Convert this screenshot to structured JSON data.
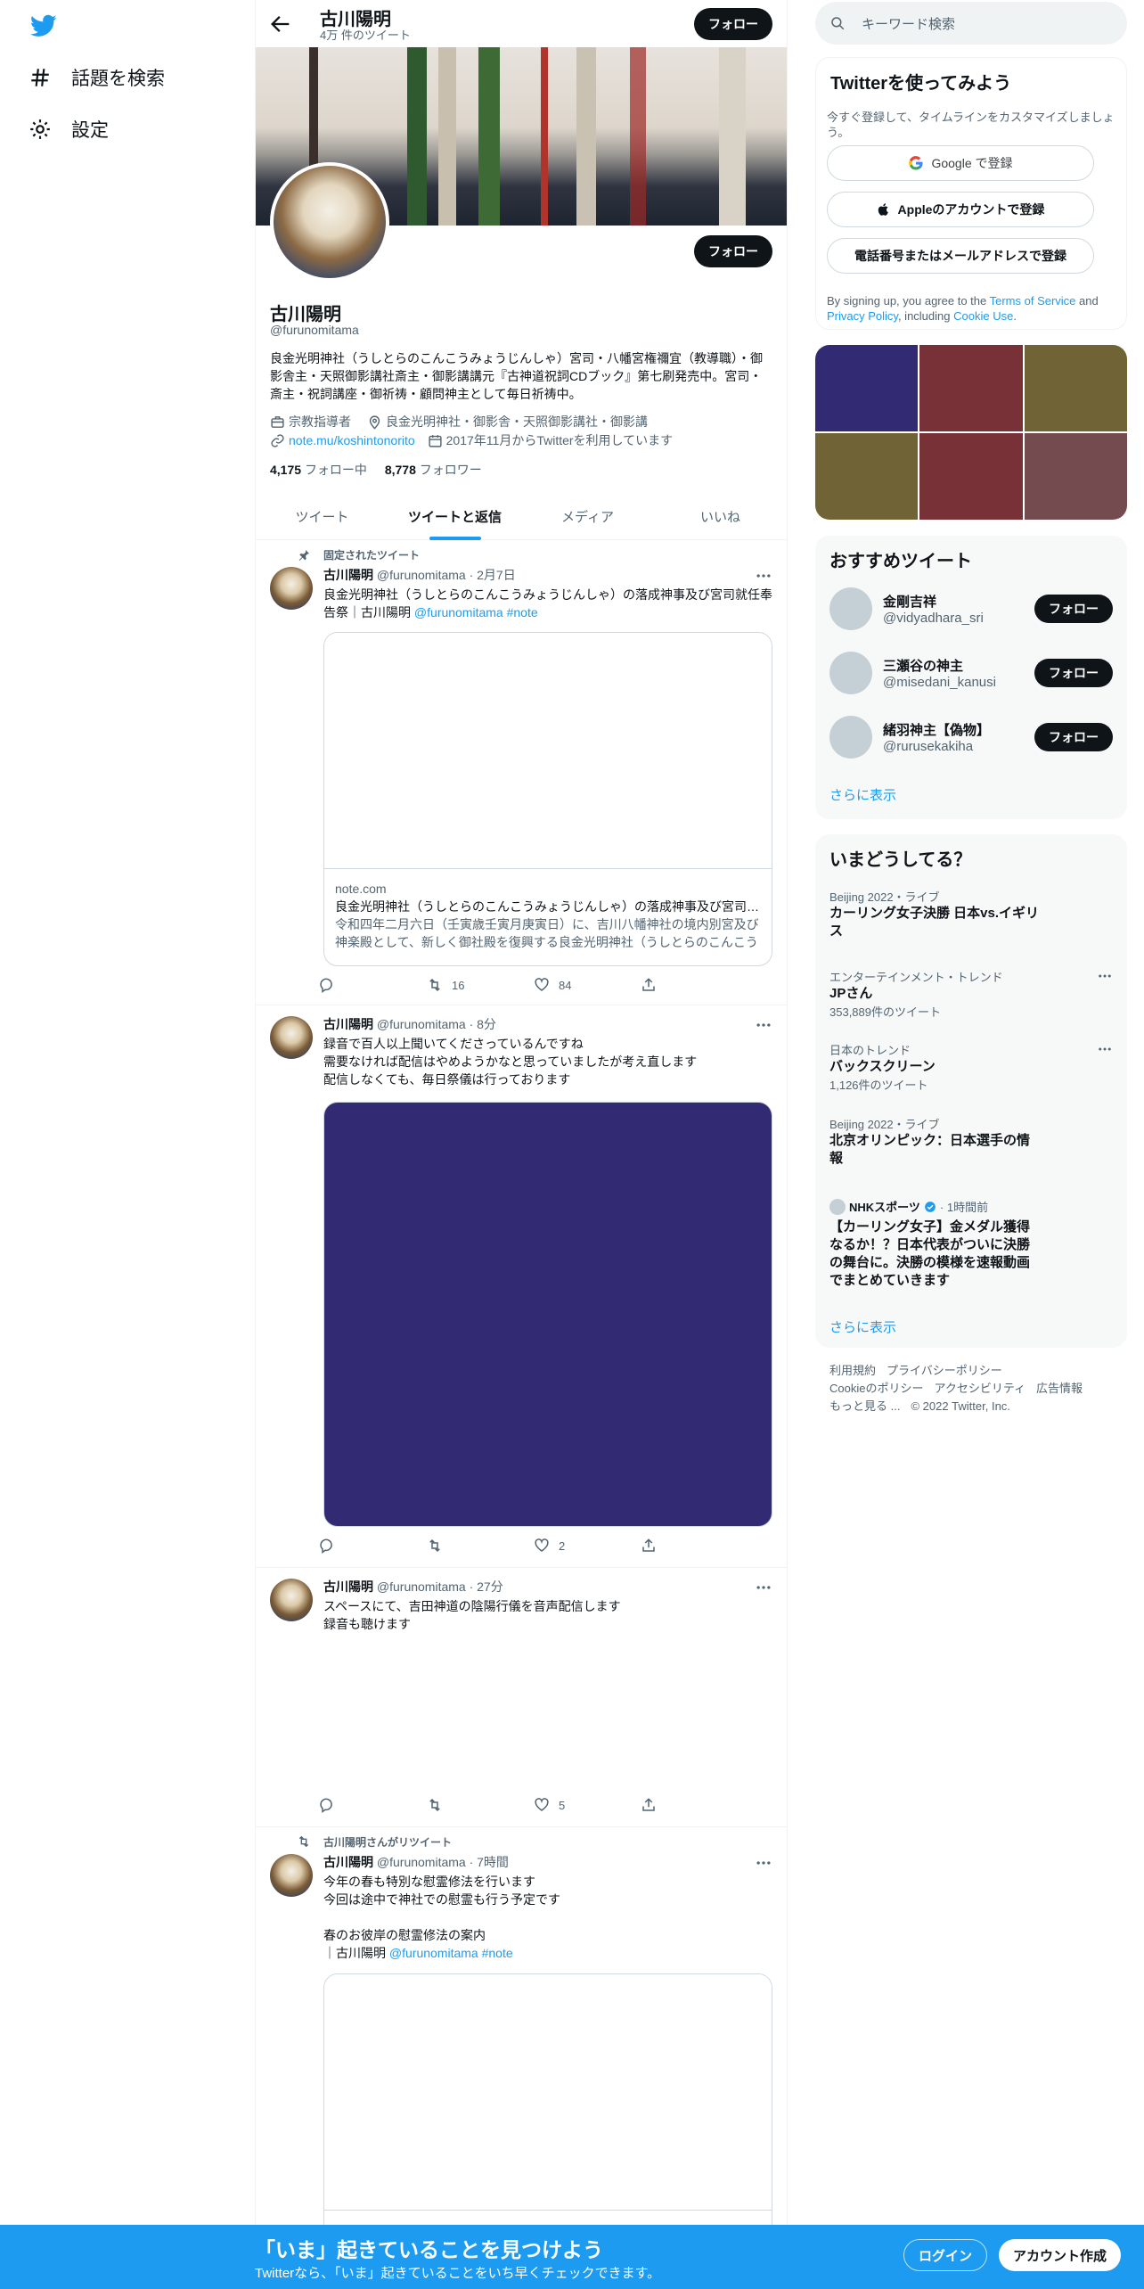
{
  "nav": {
    "explore_label": "話題を検索",
    "settings_label": "設定"
  },
  "header": {
    "title": "古川陽明",
    "subtitle": "4万 件のツイート",
    "follow_label": "フォロー"
  },
  "profile": {
    "name": "古川陽明",
    "handle": "@furunomitama",
    "follow_label": "フォロー",
    "bio": "良金光明神社（うしとらのこんこうみょうじんしゃ）宮司・八幡宮権禰宜（教導職）・御影舎主・天照御影講社斎主・御影講講元『古神道祝詞CDブック』第七刷発売中。宮司・斎主・祝詞講座・御祈祷・顧問神主として毎日祈祷中。",
    "category": "宗教指導者",
    "location": "良金光明神社・御影舎・天照御影講社・御影講",
    "link": "note.mu/koshintonorito",
    "joined": "2017年11月からTwitterを利用しています",
    "following_count": "4,175",
    "following_label": "フォロー中",
    "followers_count": "8,778",
    "followers_label": "フォロワー"
  },
  "tabs": [
    "ツイート",
    "ツイートと返信",
    "メディア",
    "いいね"
  ],
  "tweets": [
    {
      "context": "固定されたツイート",
      "name": "古川陽明",
      "handle": "@furunomitama",
      "time": "· 2月7日",
      "text": "良金光明神社（うしとらのこんこうみょうじんしゃ）の落成神事及び宮司就任奉告祭｜古川陽明 ",
      "mention": "@furunomitama",
      "hashtag": "#note",
      "card": {
        "domain": "note.com",
        "title": "良金光明神社（うしとらのこんこうみょうじんしゃ）の落成神事及び宮司就任奉告祭｜古川陽明",
        "desc": "令和四年二月六日（壬寅歳壬寅月庚寅日）に、吉川八幡神社の境内別宮及び神楽殿として、新しく御社殿を復興する良金光明神社（うしとらのこんこうみょうじんしゃ）"
      },
      "replies": "",
      "retweets": "16",
      "likes": "84"
    },
    {
      "name": "古川陽明",
      "handle": "@furunomitama",
      "time": "· 8分",
      "text": "録音で百人以上聞いてくださっているんですね\n需要なければ配信はやめようかなと思っていましたが考え直します\n配信しなくても、毎日祭儀は行っております",
      "media_color": "#332a74",
      "replies": "",
      "retweets": "",
      "likes": "2"
    },
    {
      "name": "古川陽明",
      "handle": "@furunomitama",
      "time": "· 27分",
      "text": "スペースにて、吉田神道の陰陽行儀を音声配信します\n録音も聴けます",
      "replies": "",
      "retweets": "",
      "likes": "5"
    },
    {
      "context": "古川陽明さんがリツイート",
      "name": "古川陽明",
      "handle": "@furunomitama",
      "time": "· 7時間",
      "text": "今年の春も特別な慰霊修法を行います\n今回は途中で神社での慰霊も行う予定です\n\n春のお彼岸の慰霊修法の案内\n｜古川陽明 ",
      "mention": "@furunomitama",
      "hashtag": "#note"
    }
  ],
  "search": {
    "placeholder": "キーワード検索"
  },
  "signup": {
    "title": "Twitterを使ってみよう",
    "subtitle": "今すぐ登録して、タイムラインをカスタマイズしましょう。",
    "google_label": "Google で登録",
    "apple_label": "Appleのアカウントで登録",
    "phone_label": "電話番号またはメールアドレスで登録",
    "legal_prefix": "By signing up, you agree to the ",
    "terms": "Terms of Service",
    "and": " and ",
    "privacy": "Privacy Policy",
    "including": ", including ",
    "cookie": "Cookie Use",
    "period": "."
  },
  "media_grid_colors": [
    "#332a74",
    "#793138",
    "#706437",
    "#706437",
    "#793138",
    "#744b4f"
  ],
  "recommended": {
    "title": "おすすめツイート",
    "users": [
      {
        "name": "金剛吉祥",
        "handle": "@vidyadhara_sri",
        "button": "フォロー"
      },
      {
        "name": "三瀬谷の神主",
        "handle": "@misedani_kanusi",
        "button": "フォロー"
      },
      {
        "name": "緒羽神主【偽物】",
        "handle": "@rurusekakiha",
        "button": "フォロー"
      }
    ],
    "more": "さらに表示"
  },
  "trends": {
    "title": "いまどうしてる？",
    "items": [
      {
        "category": "Beijing 2022・ライブ",
        "title": "カーリング女子決勝 日本vs.イギリス",
        "count": ""
      },
      {
        "category": "エンターテインメント・トレンド",
        "title": "JPさん",
        "count": "353,889件のツイート"
      },
      {
        "category": "日本のトレンド",
        "title": "バックスクリーン",
        "count": "1,126件のツイート"
      },
      {
        "category": "Beijing 2022・ライブ",
        "title": "北京オリンピック：日本選手の情報",
        "count": ""
      }
    ],
    "news": {
      "source": "NHKスポーツ",
      "time": "· 1時間前",
      "title": "【カーリング女子】金メダル獲得なるか！？日本代表がついに決勝の舞台に。決勝の模様を速報動画でまとめていきます"
    },
    "more": "さらに表示"
  },
  "footer": {
    "terms": "利用規約",
    "privacy": "プライバシーポリシー",
    "cookie": "Cookieのポリシー",
    "accessibility": "アクセシビリティ",
    "ads": "広告情報",
    "more": "もっと見る ...",
    "copyright": "© 2022 Twitter, Inc."
  },
  "bottom_bar": {
    "title": "「いま」起きていることを見つけよう",
    "subtitle": "Twitterなら、「いま」起きていることをいち早くチェックできます。",
    "login": "ログイン",
    "signup": "アカウント作成"
  }
}
